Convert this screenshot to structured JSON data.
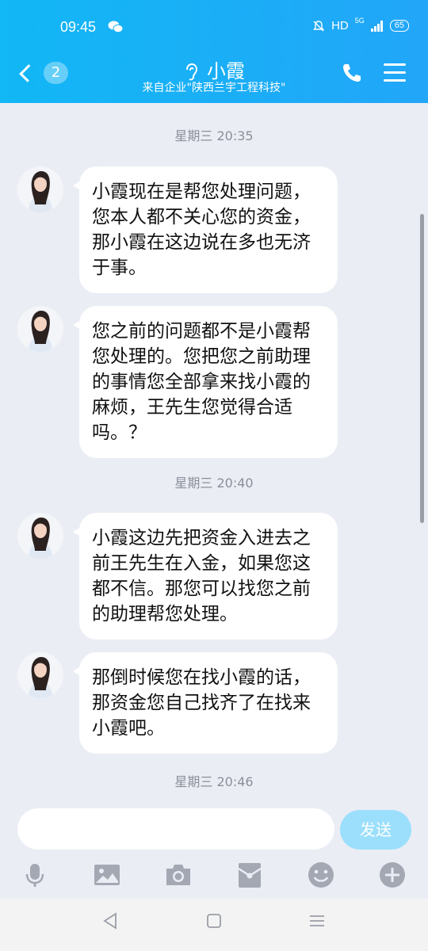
{
  "status": {
    "time": "09:45",
    "network": "HD",
    "signal": "5G",
    "battery": "65"
  },
  "header": {
    "back_badge": "2",
    "title": "小霞",
    "subtitle": "来自企业\"陕西兰宇工程科技\""
  },
  "messages": [
    {
      "type": "time",
      "text": "星期三 20:35"
    },
    {
      "type": "msg",
      "text": "小霞现在是帮您处理问题，您本人都不关心您的资金，那小霞在这边说在多也无济于事。"
    },
    {
      "type": "msg",
      "text": "您之前的问题都不是小霞帮您处理的。您把您之前助理的事情您全部拿来找小霞的麻烦，王先生您觉得合适吗。？"
    },
    {
      "type": "time",
      "text": "星期三 20:40"
    },
    {
      "type": "msg",
      "text": "小霞这边先把资金入进去之前王先生在入金，如果您这都不信。那您可以找您之前的助理帮您处理。"
    },
    {
      "type": "msg",
      "text": "那倒时候您在找小霞的话，那资金您自己找齐了在找来小霞吧。"
    },
    {
      "type": "time",
      "text": "星期三 20:46"
    }
  ],
  "input": {
    "send_label": "发送"
  },
  "toolbar": [
    "mic-icon",
    "image-icon",
    "camera-icon",
    "redpacket-icon",
    "emoji-icon",
    "plus-icon"
  ],
  "colors": {
    "header": "#12b7f5",
    "send": "#9bdffc",
    "background": "#ebedf5"
  }
}
